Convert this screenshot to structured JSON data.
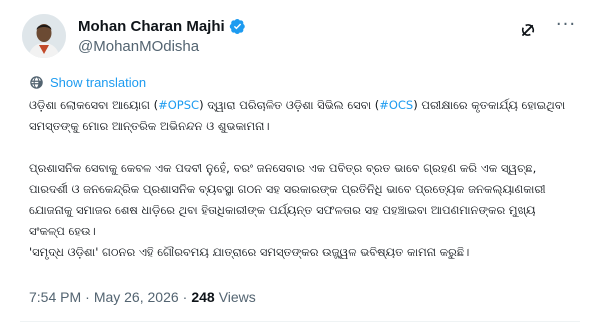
{
  "author": {
    "name": "Mohan Charan Majhi",
    "handle": "@MohanMOdisha",
    "verified": true
  },
  "colors": {
    "accent": "#1d9bf0",
    "text": "#0f1419",
    "muted": "#536471"
  },
  "icons": [
    "verified-badge-icon",
    "grok-icon",
    "more-icon",
    "translate-icon"
  ],
  "show_translation": "Show translation",
  "tweet": {
    "para1_a": "ଓଡ଼ିଶା ଲୋକସେବା ଆୟୋଗ (",
    "tag1": "#OPSC",
    "para1_b": ") ଦ୍ୱାରା ପରିଚାଳିତ ଓଡ଼ିଶା ସିଭିଲ ସେବା (",
    "tag2": "#OCS",
    "para1_c": ") ପରୀକ୍ଷାରେ କୃତକାର୍ଯ୍ୟ ହୋଇଥିବା ସମସ୍ତଙ୍କୁ ମୋର ଆନ୍ତରିକ ଅଭିନନ୍ଦନ ଓ ଶୁଭକାମନା।",
    "para2": "ପ୍ରଶାସନିକ ସେବାକୁ କେବଳ ଏକ ପଦବୀ ନୁହେଁ, ବରଂ ଜନସେବାର ଏକ ପବିତ୍ର ବ୍ରତ ଭାବେ ଗ୍ରହଣ କରି ଏକ ସ୍ୱଚ୍ଛ, ପାରଦର୍ଶୀ ଓ ଜନକେନ୍ଦ୍ରିକ ପ୍ରଶାସନିକ ବ୍ୟବସ୍ଥା ଗଠନ ସହ ସରକାରଙ୍କ ପ୍ରତିନିଧି ଭାବେ ପ୍ରତ୍ୟେକ ଜନକଲ୍ୟାଣକାରୀ ଯୋଜନାକୁ ସମାଜର ଶେଷ ଧାଡ଼ିରେ ଥିବା ହିତାଧିକାରୀଙ୍କ ପର୍ଯ୍ୟନ୍ତ ସଫଳତାର ସହ ପହଞ୍ଚାଇବା ଆପଣମାନଙ୍କର ମୁଖ୍ୟ ସଂକଳ୍ପ ହେଉ।",
    "para3": "'ସମୃଦ୍ଧ ଓଡ଼ିଶା' ଗଠନର ଏହି ଗୌରବମୟ ଯାତ୍ରାରେ ସମସ୍ତଙ୍କର ଉଜ୍ଜ୍ୱଳ ଭବିଷ୍ୟତ କାମନା କରୁଛି।"
  },
  "meta": {
    "time": "7:54 PM",
    "date": "May 26, 2026",
    "separator": "·",
    "views_count": "248",
    "views_label": "Views"
  }
}
